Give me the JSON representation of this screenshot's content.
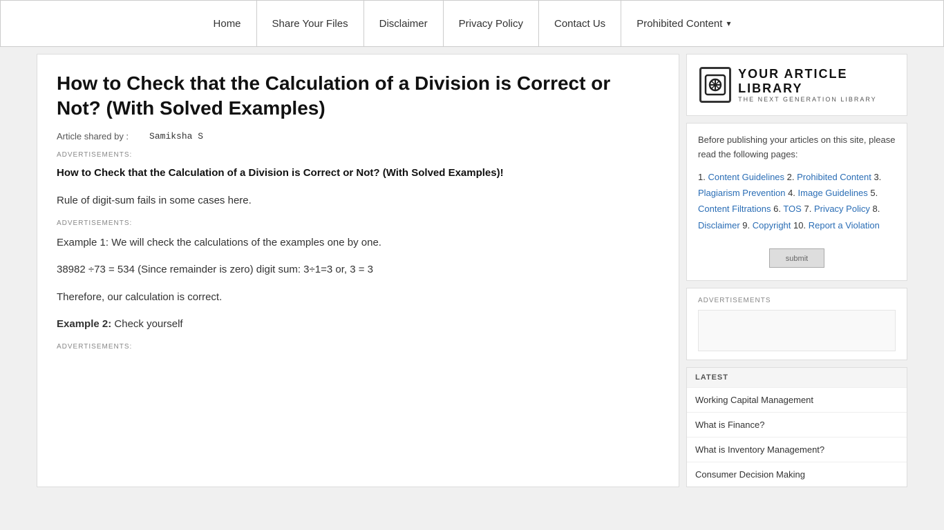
{
  "nav": {
    "items": [
      {
        "label": "Home",
        "id": "home"
      },
      {
        "label": "Share Your Files",
        "id": "share-files"
      },
      {
        "label": "Disclaimer",
        "id": "disclaimer"
      },
      {
        "label": "Privacy Policy",
        "id": "privacy-policy"
      },
      {
        "label": "Contact Us",
        "id": "contact-us"
      },
      {
        "label": "Prohibited Content",
        "id": "prohibited-content",
        "hasDropdown": true
      }
    ]
  },
  "article": {
    "title": "How to Check that the Calculation of a Division is Correct or Not? (With Solved Examples)",
    "byline_label": "Article shared by :",
    "author": "Samiksha S",
    "ads_label_1": "ADVERTISEMENTS:",
    "subtitle": "How to Check that the Calculation of a Division is Correct or Not? (With Solved Examples)!",
    "body_p1": "Rule of digit-sum fails in some cases here.",
    "ads_label_2": "ADVERTISEMENTS:",
    "body_p2": "Example 1: We will check the calculations of the examples one by one.",
    "body_p3": "38982 ÷73 = 534 (Since remainder is zero) digit sum: 3÷1=3 or, 3 = 3",
    "body_p4": "Therefore, our calculation is correct.",
    "example2_label": "Example 2:",
    "example2_text": "Check yourself",
    "ads_label_3": "ADVERTISEMENTS:"
  },
  "sidebar": {
    "logo": {
      "icon": "✎",
      "title": "Your Article Library",
      "subtitle": "The Next Generation Library"
    },
    "info_intro": "Before publishing your articles on this site, please read the following pages:",
    "info_links": [
      {
        "num": "1.",
        "text": "Content Guidelines"
      },
      {
        "num": "2.",
        "text": "Prohibited Content"
      },
      {
        "num": "3.",
        "text": "Plagiarism Prevention"
      },
      {
        "num": "4.",
        "text": "Image Guidelines"
      },
      {
        "num": "5.",
        "text": "Content Filtrations"
      },
      {
        "num": "6.",
        "text": "TOS"
      },
      {
        "num": "7.",
        "text": "Privacy Policy"
      },
      {
        "num": "8.",
        "text": "Disclaimer"
      },
      {
        "num": "9.",
        "text": "Copyright"
      },
      {
        "num": "10.",
        "text": "Report a Violation"
      }
    ],
    "ads_label": "ADVERTISEMENTS",
    "latest_label": "LATEST",
    "latest_items": [
      "Working Capital Management",
      "What is Finance?",
      "What is Inventory Management?",
      "Consumer Decision Making"
    ]
  }
}
